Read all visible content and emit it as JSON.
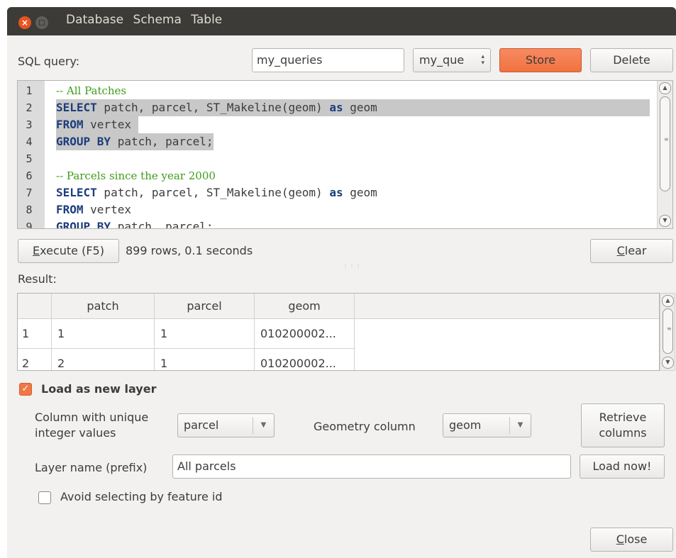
{
  "menu": [
    "Database",
    "Schema",
    "Table"
  ],
  "query_label": "SQL query:",
  "query_name_input": "my_queries",
  "saved_query_combo": "my_que",
  "store_label": "Store",
  "delete_label": "Delete",
  "editor_lines": [
    {
      "n": "1",
      "parts": [
        {
          "t": "-- All Patches",
          "c": "comment"
        }
      ],
      "hl": false
    },
    {
      "n": "2",
      "parts": [
        {
          "t": "SELECT",
          "c": "kw"
        },
        {
          "t": " patch, parcel, ST_Makeline(geom) ",
          "c": ""
        },
        {
          "t": "as",
          "c": "kw"
        },
        {
          "t": " geom",
          "c": ""
        }
      ],
      "hl": true,
      "hl_full": true
    },
    {
      "n": "3",
      "parts": [
        {
          "t": "FROM",
          "c": "kw"
        },
        {
          "t": " vertex ",
          "c": ""
        }
      ],
      "hl": true
    },
    {
      "n": "4",
      "parts": [
        {
          "t": "GROUP BY",
          "c": "kw"
        },
        {
          "t": " patch, parcel;",
          "c": ""
        }
      ],
      "hl": true
    },
    {
      "n": "5",
      "parts": [],
      "hl": false
    },
    {
      "n": "6",
      "parts": [
        {
          "t": "-- Parcels since the year 2000",
          "c": "comment"
        }
      ],
      "hl": false
    },
    {
      "n": "7",
      "parts": [
        {
          "t": "SELECT",
          "c": "kw"
        },
        {
          "t": " patch, parcel, ST_Makeline(geom) ",
          "c": ""
        },
        {
          "t": "as",
          "c": "kw"
        },
        {
          "t": " geom",
          "c": ""
        }
      ],
      "hl": false
    },
    {
      "n": "8",
      "parts": [
        {
          "t": "FROM",
          "c": "kw"
        },
        {
          "t": " vertex",
          "c": ""
        }
      ],
      "hl": false
    },
    {
      "n": "9",
      "parts": [
        {
          "t": "GROUP BY",
          "c": "kw"
        },
        {
          "t": " patch, parcel;",
          "c": ""
        }
      ],
      "hl": false
    }
  ],
  "execute_label": "Execute (F5)",
  "execute_mnemonic": "E",
  "status_text": "899 rows, 0.1 seconds",
  "clear_label": "Clear",
  "result_label": "Result:",
  "table": {
    "headers": [
      "patch",
      "parcel",
      "geom"
    ],
    "rows": [
      {
        "num": "1",
        "cells": [
          "1",
          "1",
          "010200002..."
        ]
      },
      {
        "num": "2",
        "cells": [
          "2",
          "1",
          "010200002..."
        ]
      }
    ]
  },
  "load_as_layer_label": "Load as new layer",
  "load_as_layer_checked": true,
  "unique_col_label_1": "Column with unique",
  "unique_col_label_2": "integer values",
  "unique_col_value": "parcel",
  "geom_col_label": "Geometry column",
  "geom_col_value": "geom",
  "retrieve_label_1": "Retrieve",
  "retrieve_label_2": "columns",
  "layer_name_label": "Layer name (prefix)",
  "layer_name_value": "All parcels",
  "load_now_label": "Load now!",
  "avoid_select_label": "Avoid selecting by feature id",
  "avoid_select_checked": false,
  "close_label": "Close",
  "colors": {
    "titlebar": "#3c3b37",
    "accent": "#f07241",
    "keyword": "#1d3d7d",
    "comment": "#3f9c1a"
  }
}
